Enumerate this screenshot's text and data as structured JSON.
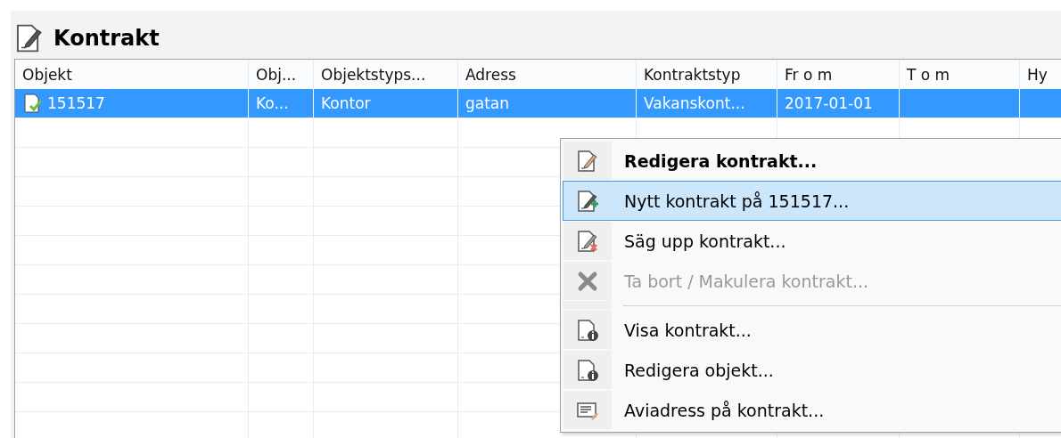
{
  "panel": {
    "title": "Kontrakt"
  },
  "table": {
    "columns": [
      "Objekt",
      "Obj...",
      "Objektstyps...",
      "Adress",
      "Kontraktstyp",
      "Fr o m",
      "T o m",
      "Hy"
    ],
    "rows": [
      {
        "selected": true,
        "cells": [
          "151517",
          "Ko...",
          "Kontor",
          "gatan",
          "Vakanskont...",
          "2017-01-01",
          "",
          ""
        ]
      }
    ]
  },
  "context_menu": {
    "items": [
      {
        "label": "Redigera kontrakt...",
        "default": true,
        "selected": false,
        "disabled": false,
        "separator_before": false
      },
      {
        "label": "Nytt kontrakt på 151517...",
        "default": false,
        "selected": true,
        "disabled": false,
        "separator_before": false
      },
      {
        "label": "Säg upp kontrakt...",
        "default": false,
        "selected": false,
        "disabled": false,
        "separator_before": false
      },
      {
        "label": "Ta bort / Makulera kontrakt...",
        "default": false,
        "selected": false,
        "disabled": true,
        "separator_before": false
      },
      {
        "label": "Visa kontrakt...",
        "default": false,
        "selected": false,
        "disabled": false,
        "separator_before": true
      },
      {
        "label": "Redigera objekt...",
        "default": false,
        "selected": false,
        "disabled": false,
        "separator_before": false
      },
      {
        "label": "Aviadress på kontrakt...",
        "default": false,
        "selected": false,
        "disabled": false,
        "separator_before": false
      }
    ]
  }
}
